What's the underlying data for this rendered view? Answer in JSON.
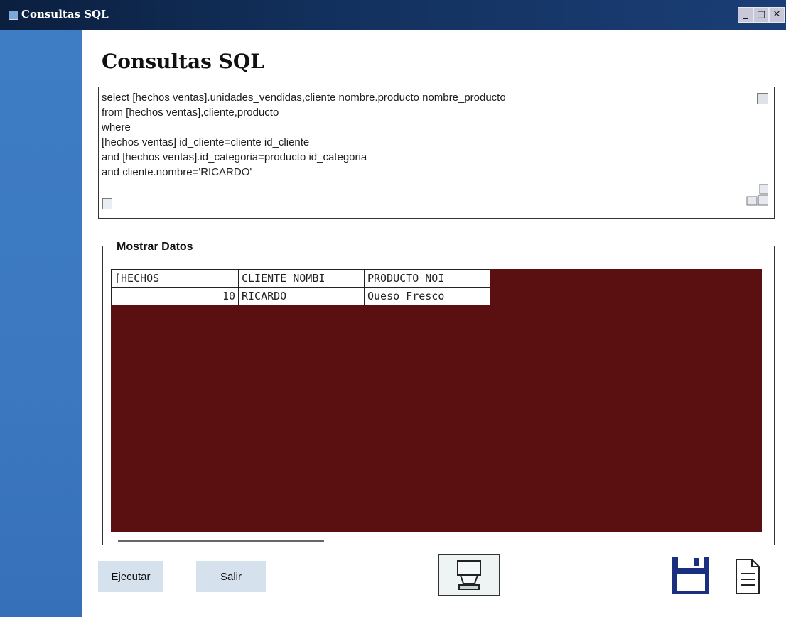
{
  "window": {
    "title": "Consultas SQL",
    "controls": [
      "minimize-icon",
      "maximize-icon",
      "close-icon"
    ]
  },
  "form": {
    "heading": "Consultas SQL",
    "sql_query_lines": [
      "select [hechos ventas].unidades_vendidas,cliente nombre.producto nombre_producto",
      "from [hechos ventas],cliente,producto",
      "where",
      "[hechos ventas] id_cliente=cliente id_cliente",
      "and [hechos ventas].id_categoria=producto id_categoria",
      "and cliente.nombre='RICARDO'"
    ]
  },
  "results": {
    "group_label": "Mostrar Datos",
    "columns": [
      "[HECHOS",
      "CLIENTE NOMBI",
      "PRODUCTO NOI"
    ],
    "rows": [
      [
        "10",
        "RICARDO",
        "Queso Fresco"
      ]
    ]
  },
  "buttons": {
    "execute": "Ejecutar",
    "exit": "Salir"
  },
  "icons": {
    "print": "printer-icon",
    "save": "floppy-disk-icon",
    "document": "document-icon"
  },
  "colors": {
    "titlebar": "#12305c",
    "sidebar": "#3b78c0",
    "grid_background": "#5a0f10",
    "button": "#d6e1ee"
  }
}
